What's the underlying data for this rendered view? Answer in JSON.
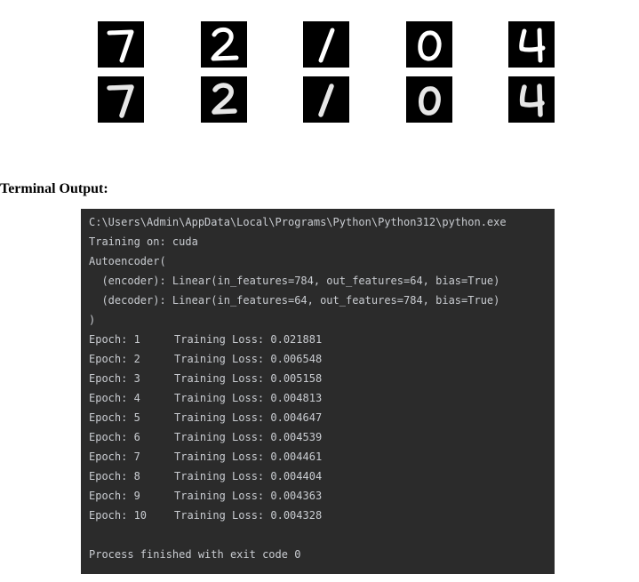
{
  "digits": {
    "original_row": [
      "7",
      "2",
      "1",
      "0",
      "4"
    ],
    "reconstructed_row": [
      "7",
      "2",
      "1",
      "0",
      "4"
    ]
  },
  "section_title": "Terminal Output:",
  "terminal": {
    "command": "C:\\Users\\Admin\\AppData\\Local\\Programs\\Python\\Python312\\python.exe",
    "device": "Training on: cuda",
    "model_open": "Autoencoder(",
    "encoder": "  (encoder): Linear(in_features=784, out_features=64, bias=True)",
    "decoder": "  (decoder): Linear(in_features=64, out_features=784, bias=True)",
    "model_close": ")",
    "epochs": [
      {
        "epoch": "Epoch: 1",
        "loss": "Training Loss: 0.021881"
      },
      {
        "epoch": "Epoch: 2",
        "loss": "Training Loss: 0.006548"
      },
      {
        "epoch": "Epoch: 3",
        "loss": "Training Loss: 0.005158"
      },
      {
        "epoch": "Epoch: 4",
        "loss": "Training Loss: 0.004813"
      },
      {
        "epoch": "Epoch: 5",
        "loss": "Training Loss: 0.004647"
      },
      {
        "epoch": "Epoch: 6",
        "loss": "Training Loss: 0.004539"
      },
      {
        "epoch": "Epoch: 7",
        "loss": "Training Loss: 0.004461"
      },
      {
        "epoch": "Epoch: 8",
        "loss": "Training Loss: 0.004404"
      },
      {
        "epoch": "Epoch: 9",
        "loss": "Training Loss: 0.004363"
      },
      {
        "epoch": "Epoch: 10",
        "loss": "Training Loss: 0.004328"
      }
    ],
    "blank": "",
    "exit": "Process finished with exit code 0"
  },
  "colors": {
    "terminal_bg": "#2b2b2b",
    "terminal_text": "#c9ccd1",
    "digit_bg": "#000000",
    "digit_stroke": "#ffffff"
  }
}
